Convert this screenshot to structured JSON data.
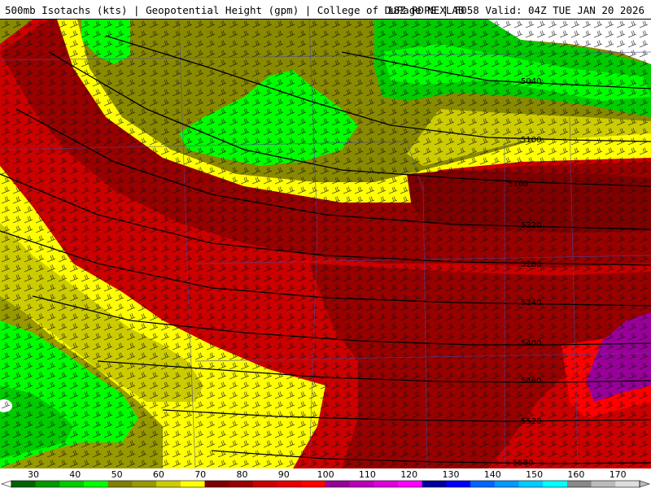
{
  "header": {
    "left_title": "500mb Isotachs (kts) | Geopotential Height (gpm) | College of DuPage NEXLAB",
    "right_title": "18Z RDPS | F058 Valid: 04Z TUE JAN 20 2026"
  },
  "map": {
    "height_contours": [
      {
        "label": "5040",
        "value": 5040
      },
      {
        "label": "5100",
        "value": 5100
      },
      {
        "label": "5160",
        "value": 5160
      },
      {
        "label": "5220",
        "value": 5220
      },
      {
        "label": "5280",
        "value": 5280
      },
      {
        "label": "5340",
        "value": 5340
      },
      {
        "label": "5400",
        "value": 5400
      },
      {
        "label": "5460",
        "value": 5460
      },
      {
        "label": "5520",
        "value": 5520
      },
      {
        "label": "5580",
        "value": 5580
      }
    ]
  },
  "legend": {
    "ticks": [
      "30",
      "40",
      "50",
      "60",
      "70",
      "80",
      "90",
      "100",
      "110",
      "120",
      "130",
      "140",
      "150",
      "160",
      "170"
    ],
    "colors": [
      "#006400",
      "#009900",
      "#00cc00",
      "#00ff00",
      "#808000",
      "#999900",
      "#cccc00",
      "#ffff00",
      "#800000",
      "#990000",
      "#cc0000",
      "#e60000",
      "#ff0000",
      "#990099",
      "#bb00bb",
      "#dd00dd",
      "#ff00ff",
      "#000099",
      "#0000ff",
      "#0066ff",
      "#0099ff",
      "#00ccff",
      "#00ffff",
      "#888888",
      "#bbbbbb",
      "#dddddd"
    ]
  }
}
